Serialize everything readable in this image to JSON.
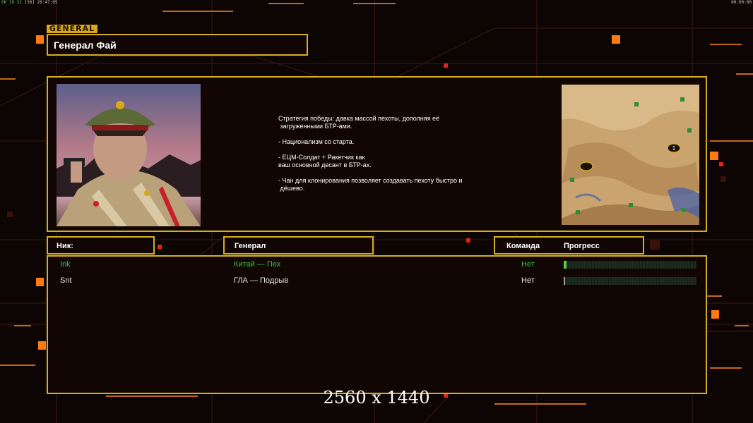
{
  "hud": {
    "status_left": "0K 30 32",
    "status_sub": "[30]",
    "clock_left": "20:47:05",
    "clock_right": "00:00:00"
  },
  "logo_text": "GENERAL",
  "general": {
    "name": "Генерал Фай",
    "description": [
      "Стратегия победы: давка массой пехоты, дополняя её",
      " загруженными БТР-ами.",
      "",
      "- Национализм со старта.",
      "",
      "- ЕЦМ-Солдат + Ракетчик как",
      "ваш основной десант в БТР-ах.",
      "",
      "- Чан для клонирования позволяет создавать пехоту быстро и",
      " дёшево."
    ]
  },
  "headers": {
    "nick": "Ник:",
    "general": "Генерал",
    "team": "Команда",
    "progress": "Прогресс"
  },
  "players": [
    {
      "nick": "Ink",
      "general": "Китай — Пех",
      "team": "Нет",
      "progress": 0.02,
      "color": "#3fbf3f"
    },
    {
      "nick": "Snt",
      "general": "ГЛА — Подрыв",
      "team": "Нет",
      "progress": 0.01,
      "color": "#e8e8e8"
    }
  ],
  "minimap": {
    "markers": [
      "1"
    ]
  },
  "resolution_text": "2560 x 1440",
  "colors": {
    "frame": "#d4b01e",
    "accent_orange": "#ff8a1a",
    "accent_red": "#e0301a",
    "background": "#0d0503"
  }
}
